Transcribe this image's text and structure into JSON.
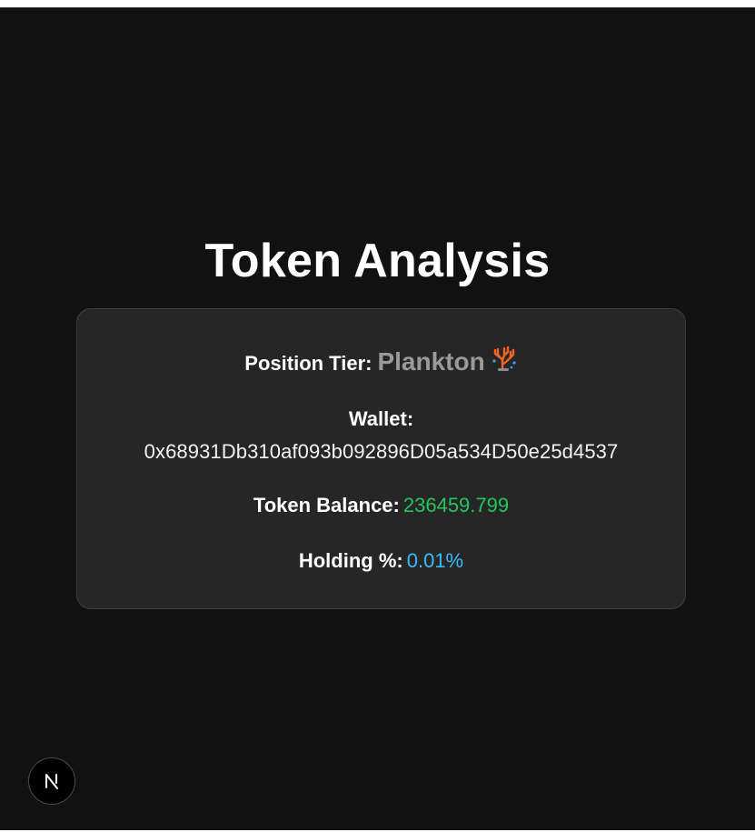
{
  "page": {
    "title": "Token Analysis"
  },
  "card": {
    "tier_label": "Position Tier:",
    "tier_value": "Plankton",
    "tier_icon": "coral-icon",
    "wallet_label": "Wallet:",
    "wallet_address": "0x68931Db310af093b092896D05a534D50e25d4537",
    "balance_label": "Token Balance:",
    "balance_value": "236459.799",
    "holding_label": "Holding %:",
    "holding_value": "0.01%"
  },
  "colors": {
    "background": "#111111",
    "card_background": "#262626",
    "tier_value": "#9a9a9a",
    "balance_value": "#22c55e",
    "holding_value": "#38bdf8"
  },
  "dev_badge": {
    "icon": "nextjs-logo-icon",
    "letter": "N"
  }
}
